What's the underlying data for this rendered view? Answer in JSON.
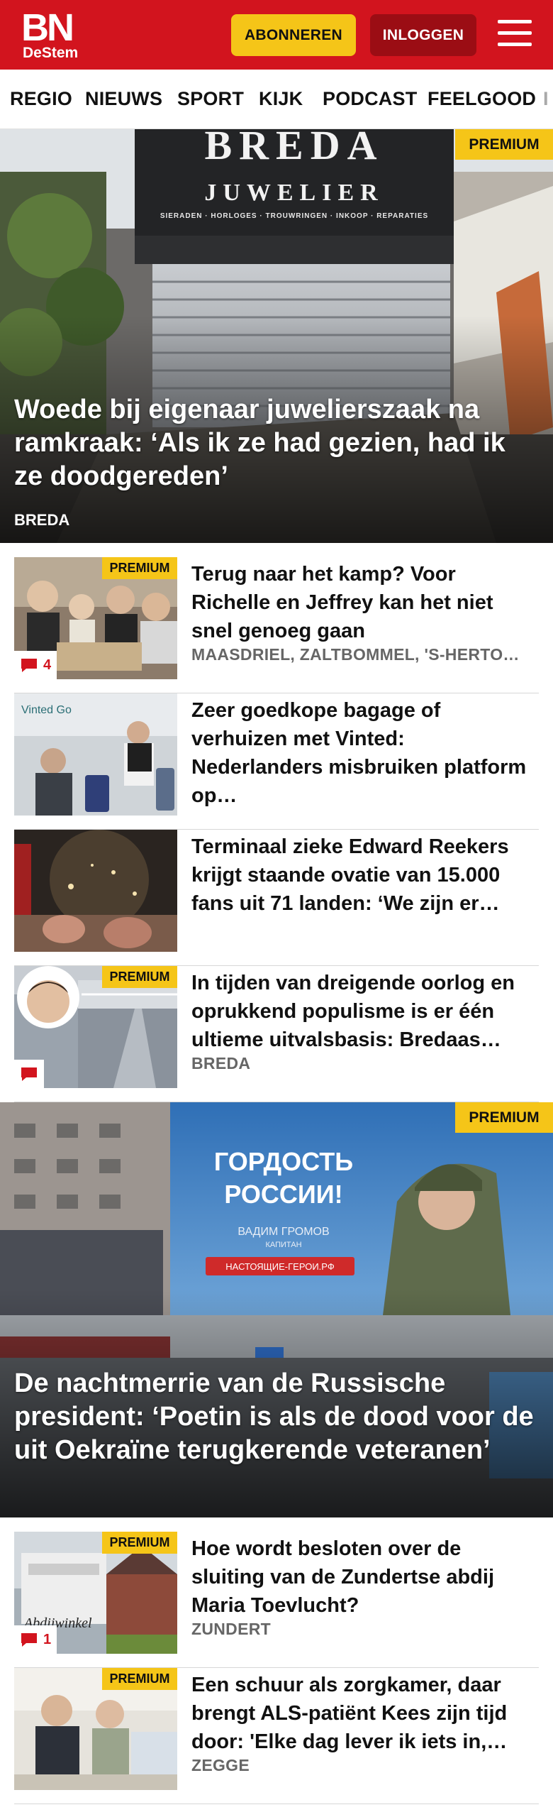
{
  "brand": {
    "logo_main": "BN",
    "logo_sub": "DeStem"
  },
  "header": {
    "subscribe_label": "ABONNEREN",
    "login_label": "INLOGGEN"
  },
  "nav": {
    "items": [
      "REGIO",
      "NIEUWS",
      "SPORT",
      "KIJK",
      "PODCAST",
      "FEELGOOD",
      "I"
    ]
  },
  "badge": "PREMIUM",
  "hero1": {
    "store_sign": "BREDA",
    "store_sub": "JUWELIER",
    "store_tagline": "SIERADEN · HORLOGES · TROUWRINGEN · INKOOP · REPARATIES",
    "title": "Woede bij eigenaar juwelierszaak na ramkraak: ‘Als ik ze had gezien, had ik ze doodgereden’",
    "location": "BREDA"
  },
  "articles": [
    {
      "title": "Terug naar het kamp? Voor Richelle en Jeffrey kan het niet snel genoeg gaan",
      "location": "MAASDRIEL, ZALTBOMMEL, 'S-HERTOGENBOSCH",
      "premium": true,
      "comments": "4"
    },
    {
      "title": "Zeer goedkope bagage of verhuizen met Vinted: Nederlanders misbruiken platform op…",
      "location": "",
      "premium": false,
      "comments": null,
      "thumb_text": "Vinted Go"
    },
    {
      "title": "Terminaal zieke Edward Reekers krijgt staande ovatie van 15.000 fans uit 71 landen: ‘We zijn er…",
      "location": "",
      "premium": false,
      "comments": null
    },
    {
      "title": "In tijden van dreigende oorlog en oprukkend populisme is er één ultieme uitvalsbasis: Bredaas…",
      "location": "BREDA",
      "premium": true,
      "comments": ""
    }
  ],
  "hero2": {
    "billboard_line1": "ГОРДОСТЬ",
    "billboard_line2": "РОССИИ!",
    "billboard_name": "ВАДИМ ГРОМОВ",
    "billboard_rank": "КАПИТАН",
    "billboard_site": "НАСТОЯЩИЕ-ГЕРОИ.РФ",
    "title": "De nachtmerrie van de Russische president: ‘Poetin is als de dood voor de uit Oekraïne terugkerende veteranen’"
  },
  "articles2": [
    {
      "title": "Hoe wordt besloten over de sluiting van de Zundertse abdij Maria Toevlucht?",
      "location": "ZUNDERT",
      "premium": true,
      "comments": "1",
      "thumb_text": "Abdijwinkel"
    },
    {
      "title": "Een schuur als zorgkamer, daar brengt ALS-patiënt Kees zijn tijd door: 'Elke dag lever ik iets in,…",
      "location": "ZEGGE",
      "premium": true,
      "comments": null
    }
  ],
  "colors": {
    "brand_red": "#d2141e",
    "premium_yellow": "#f5c518",
    "login_dark_red": "#9b0d14"
  }
}
